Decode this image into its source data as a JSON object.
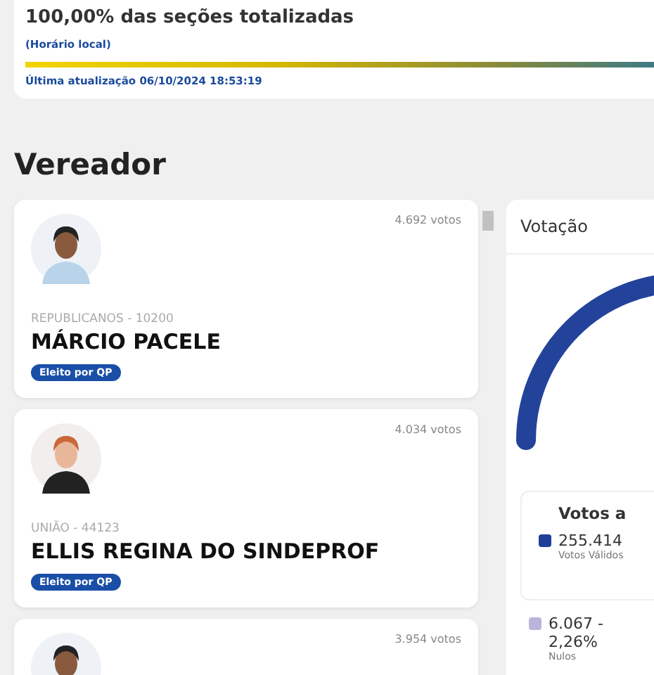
{
  "header": {
    "title": "100,00% das seções totalizadas",
    "timezone_note": "(Horário local)",
    "progress": {
      "level": 1
    },
    "last_update": "Última atualização 06/10/2024 18:53:19"
  },
  "section_title": "Vereador",
  "candidates": [
    {
      "votes": "4.692 votos",
      "party": "REPUBLICANOS - 10200",
      "name": "MÁRCIO PACELE",
      "badge": "Eleito por QP"
    },
    {
      "votes": "4.034 votos",
      "party": "UNIÃO - 44123",
      "name": "ELLIS REGINA DO SINDEPROF",
      "badge": "Eleito por QP"
    },
    {
      "votes": "3.954 votos"
    }
  ],
  "voting_panel": {
    "title": "Votação",
    "summary": {
      "title": "Votos a",
      "items": [
        {
          "value": "255.414",
          "label": "Votos Válidos",
          "color": "#1f3f99"
        }
      ]
    },
    "breakdown": [
      {
        "value": "6.067 -\n2,26%",
        "label": "Nulos",
        "color": "#b9b5dc"
      }
    ]
  }
}
